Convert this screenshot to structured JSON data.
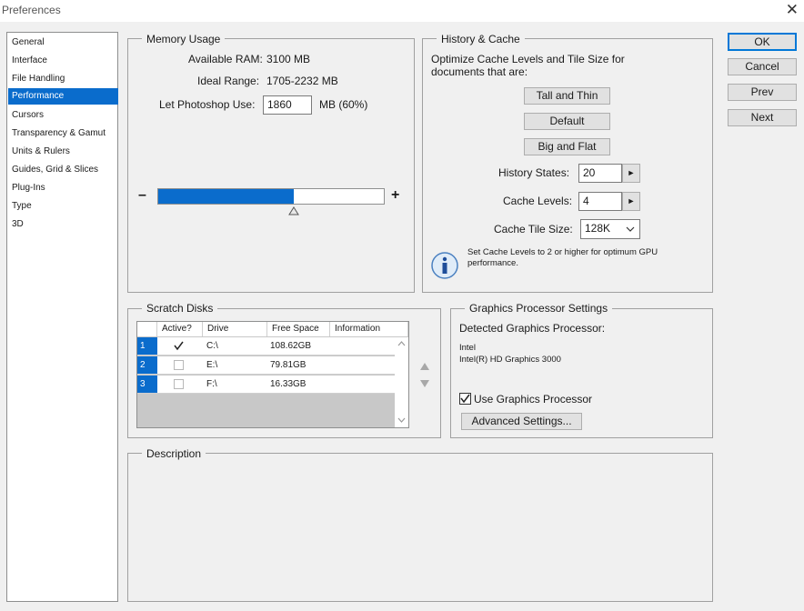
{
  "window": {
    "title": "Preferences"
  },
  "sidebar": {
    "items": [
      {
        "label": "General"
      },
      {
        "label": "Interface"
      },
      {
        "label": "File Handling"
      },
      {
        "label": "Performance",
        "selected": true
      },
      {
        "label": "Cursors"
      },
      {
        "label": "Transparency & Gamut"
      },
      {
        "label": "Units & Rulers"
      },
      {
        "label": "Guides, Grid & Slices"
      },
      {
        "label": "Plug-Ins"
      },
      {
        "label": "Type"
      },
      {
        "label": "3D"
      }
    ]
  },
  "memory": {
    "title": "Memory Usage",
    "available_label": "Available RAM:",
    "available_value": "3100 MB",
    "ideal_label": "Ideal Range:",
    "ideal_value": "1705-2232 MB",
    "let_label": "Let Photoshop Use:",
    "let_value": "1860",
    "let_unit": "MB (60%)",
    "slider_fraction": 0.6,
    "minus": "–",
    "plus": "+"
  },
  "cache": {
    "title": "History & Cache",
    "description": "Optimize Cache Levels and Tile Size for documents that are:",
    "buttons": [
      "Tall and Thin",
      "Default",
      "Big and Flat"
    ],
    "history_label": "History States:",
    "history_value": "20",
    "levels_label": "Cache Levels:",
    "levels_value": "4",
    "tile_label": "Cache Tile Size:",
    "tile_value": "128K",
    "info_text": "Set Cache Levels to 2 or higher for optimum GPU performance."
  },
  "scratch": {
    "title": "Scratch Disks",
    "columns": [
      "Active?",
      "Drive",
      "Free Space",
      "Information"
    ],
    "rows": [
      {
        "num": "1",
        "active": true,
        "drive": "C:\\",
        "free": "108.62GB",
        "info": ""
      },
      {
        "num": "2",
        "active": false,
        "drive": "E:\\",
        "free": "79.81GB",
        "info": ""
      },
      {
        "num": "3",
        "active": false,
        "drive": "F:\\",
        "free": "16.33GB",
        "info": ""
      }
    ]
  },
  "gpu": {
    "title": "Graphics Processor Settings",
    "detected_label": "Detected Graphics Processor:",
    "vendor": "Intel",
    "model": "Intel(R) HD Graphics 3000",
    "use_label": "Use Graphics Processor",
    "use_checked": true,
    "advanced_label": "Advanced Settings..."
  },
  "description": {
    "title": "Description"
  },
  "actions": {
    "ok": "OK",
    "cancel": "Cancel",
    "prev": "Prev",
    "next": "Next"
  }
}
